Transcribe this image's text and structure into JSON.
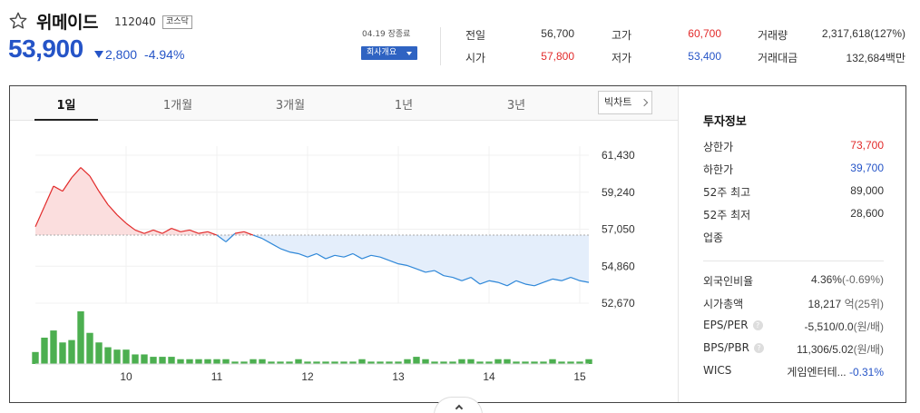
{
  "stock": {
    "name": "위메이드",
    "code": "112040",
    "market": "코스닥",
    "price": "53,900",
    "change": "2,800",
    "change_pct": "-4.94%"
  },
  "market_status": "04.19 장종료",
  "company_button": "회사개요",
  "stats": [
    {
      "label": "전일",
      "value": "56,700",
      "tone": "neutral"
    },
    {
      "label": "시가",
      "value": "57,800",
      "tone": "up"
    },
    {
      "label": "고가",
      "value": "60,700",
      "tone": "up"
    },
    {
      "label": "저가",
      "value": "53,400",
      "tone": "down"
    },
    {
      "label": "거래량",
      "value": "2,317,618(127%)",
      "tone": "neutral"
    },
    {
      "label": "거래대금",
      "value": "132,684백만",
      "tone": "neutral"
    }
  ],
  "tabs": [
    "1일",
    "1개월",
    "3개월",
    "1년",
    "3년"
  ],
  "active_tab": "1일",
  "bigchart_button": "빅차트",
  "invest_info": {
    "title": "투자정보",
    "rows": [
      {
        "label": "상한가",
        "value": "73,700",
        "tone": "up"
      },
      {
        "label": "하한가",
        "value": "39,700",
        "tone": "down"
      },
      {
        "label": "52주 최고",
        "value": "89,000",
        "tone": "neutral"
      },
      {
        "label": "52주 최저",
        "value": "28,600",
        "tone": "neutral"
      },
      {
        "label": "업종",
        "value": "",
        "tone": "neutral"
      }
    ],
    "rows2": {
      "foreign": {
        "label": "외국인비율",
        "value": "4.36%",
        "sub": "(-0.69%)"
      },
      "mcap": {
        "label": "시가총액",
        "value": "18,217",
        "unit": "억(25위)"
      },
      "eps": {
        "label": "EPS/PER",
        "value": "-5,510/0.0",
        "unit": "(원/배)"
      },
      "bps": {
        "label": "BPS/PBR",
        "value": "11,306/5.02",
        "unit": "(원/배)"
      },
      "wics": {
        "label": "WICS",
        "value": "게임엔터테...",
        "pct": "-0.31%"
      }
    },
    "help_glyph": "?"
  },
  "chart_data": {
    "type": "line",
    "baseline": 56700,
    "ylim": [
      52670,
      61430
    ],
    "yticks": [
      "61,430",
      "59,240",
      "57,050",
      "54,860",
      "52,670"
    ],
    "ytick_values": [
      61430,
      59240,
      57050,
      54860,
      52670
    ],
    "xtick_labels": [
      "10",
      "11",
      "12",
      "13",
      "14",
      "15"
    ],
    "xtick_index": [
      10,
      20,
      30,
      40,
      50,
      60
    ],
    "up_color": "#e22a2a",
    "down_color": "#2e87d8",
    "up_fill": "#fbdede",
    "down_fill": "#e4eefb",
    "volume_color": "#4caf50",
    "series": [
      {
        "name": "price",
        "values": [
          57200,
          58400,
          59600,
          59300,
          60100,
          60700,
          60200,
          59300,
          58500,
          57900,
          57400,
          57000,
          56800,
          57000,
          56800,
          57100,
          56900,
          57000,
          56800,
          56900,
          56700,
          56300,
          56800,
          56900,
          56700,
          56500,
          56200,
          55900,
          55700,
          55600,
          55400,
          55600,
          55300,
          55500,
          55400,
          55600,
          55300,
          55500,
          55400,
          55200,
          55000,
          54900,
          54700,
          54500,
          54600,
          54300,
          54200,
          54000,
          54200,
          53800,
          54000,
          53900,
          53700,
          54000,
          53800,
          53700,
          53900,
          54100,
          54000,
          54200,
          54000,
          53900
        ]
      },
      {
        "name": "volume",
        "values": [
          5,
          11,
          14,
          9,
          10,
          22,
          13,
          9,
          7,
          6,
          6,
          4,
          4,
          3,
          3,
          3,
          2,
          2,
          2,
          2,
          2,
          2,
          1,
          1,
          2,
          2,
          1,
          1,
          1,
          2,
          1,
          1,
          1,
          1,
          1,
          1,
          2,
          1,
          1,
          1,
          1,
          2,
          3,
          2,
          1,
          1,
          1,
          2,
          2,
          1,
          1,
          2,
          2,
          1,
          1,
          1,
          1,
          2,
          1,
          1,
          1,
          2
        ]
      }
    ]
  }
}
